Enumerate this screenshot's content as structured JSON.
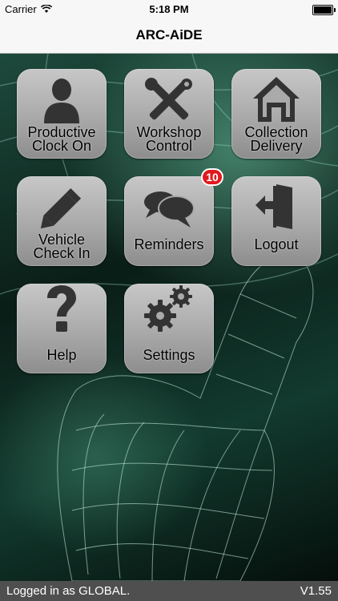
{
  "status_bar": {
    "carrier": "Carrier",
    "time": "5:18 PM"
  },
  "nav": {
    "title": "ARC-AiDE"
  },
  "tiles": [
    {
      "label_lines": [
        "Productive",
        "Clock On"
      ],
      "icon": "person-icon"
    },
    {
      "label_lines": [
        "Workshop",
        "Control"
      ],
      "icon": "tools-icon"
    },
    {
      "label_lines": [
        "Collection",
        "Delivery"
      ],
      "icon": "house-icon"
    },
    {
      "label_lines": [
        "Vehicle",
        "Check In"
      ],
      "icon": "pencil-icon"
    },
    {
      "label_lines": [
        "Reminders"
      ],
      "icon": "chat-bubbles-icon",
      "badge": "10"
    },
    {
      "label_lines": [
        "Logout"
      ],
      "icon": "logout-door-icon"
    },
    {
      "label_lines": [
        "Help"
      ],
      "icon": "question-mark-icon"
    },
    {
      "label_lines": [
        "Settings"
      ],
      "icon": "gears-icon"
    }
  ],
  "footer": {
    "login_text": "Logged in as GLOBAL.",
    "version": "V1.55"
  },
  "colors": {
    "badge": "#e0191d",
    "footer_bg": "#4f4f4f",
    "tile_bg": "#b0b0b0",
    "icon": "#333333"
  }
}
